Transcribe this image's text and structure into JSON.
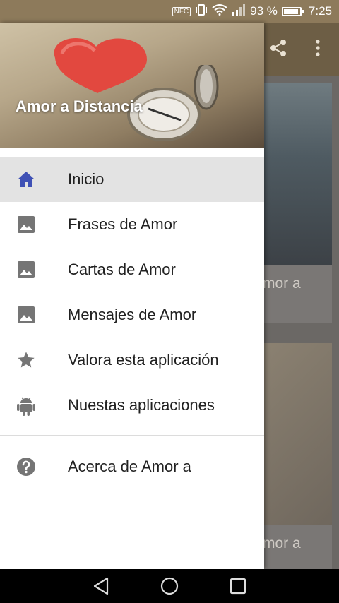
{
  "status_bar": {
    "nfc": "NFC",
    "battery_percent": "93 %",
    "battery_level": 0.93,
    "time": "7:25"
  },
  "background_app": {
    "card1_text": "mor a",
    "card2_text": "mor a"
  },
  "drawer": {
    "header_title": "Amor a Distancia",
    "items": [
      {
        "label": "Inicio",
        "icon": "home-icon",
        "active": true
      },
      {
        "label": "Frases de Amor",
        "icon": "image-icon"
      },
      {
        "label": "Cartas de Amor",
        "icon": "image-icon"
      },
      {
        "label": "Mensajes de Amor",
        "icon": "image-icon"
      },
      {
        "label": "Valora esta aplicación",
        "icon": "star-icon"
      },
      {
        "label": "Nuestas aplicaciones",
        "icon": "android-icon"
      }
    ],
    "secondary_items": [
      {
        "label": "Acerca de Amor a",
        "icon": "help-icon"
      }
    ]
  },
  "colors": {
    "active_icon": "#3f51b5",
    "icon_gray": "#757575",
    "status_bar": "#8d7a5b"
  }
}
